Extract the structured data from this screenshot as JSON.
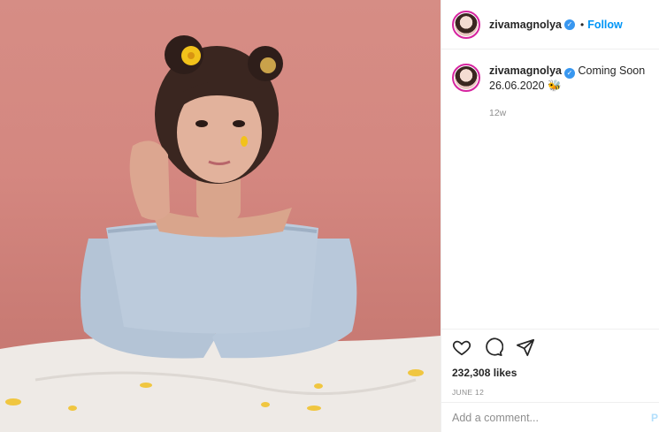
{
  "post": {
    "username": "zivamagnolya",
    "verified_icon": "verified-badge-icon",
    "follow_label": "Follow",
    "dot": "•",
    "caption_text": "Coming Soon 26.06.2020",
    "caption_emoji": "🐝",
    "time_ago": "12w",
    "likes": "232,308 likes",
    "date": "JUNE 12",
    "comment_placeholder": "Add a comment...",
    "post_label": "P"
  },
  "icons": {
    "like": "heart-icon",
    "comment": "comment-bubble-icon",
    "share": "paper-plane-icon"
  },
  "colors": {
    "follow": "#0095f6",
    "verified": "#3897f0",
    "photo_background": "#d48780"
  }
}
